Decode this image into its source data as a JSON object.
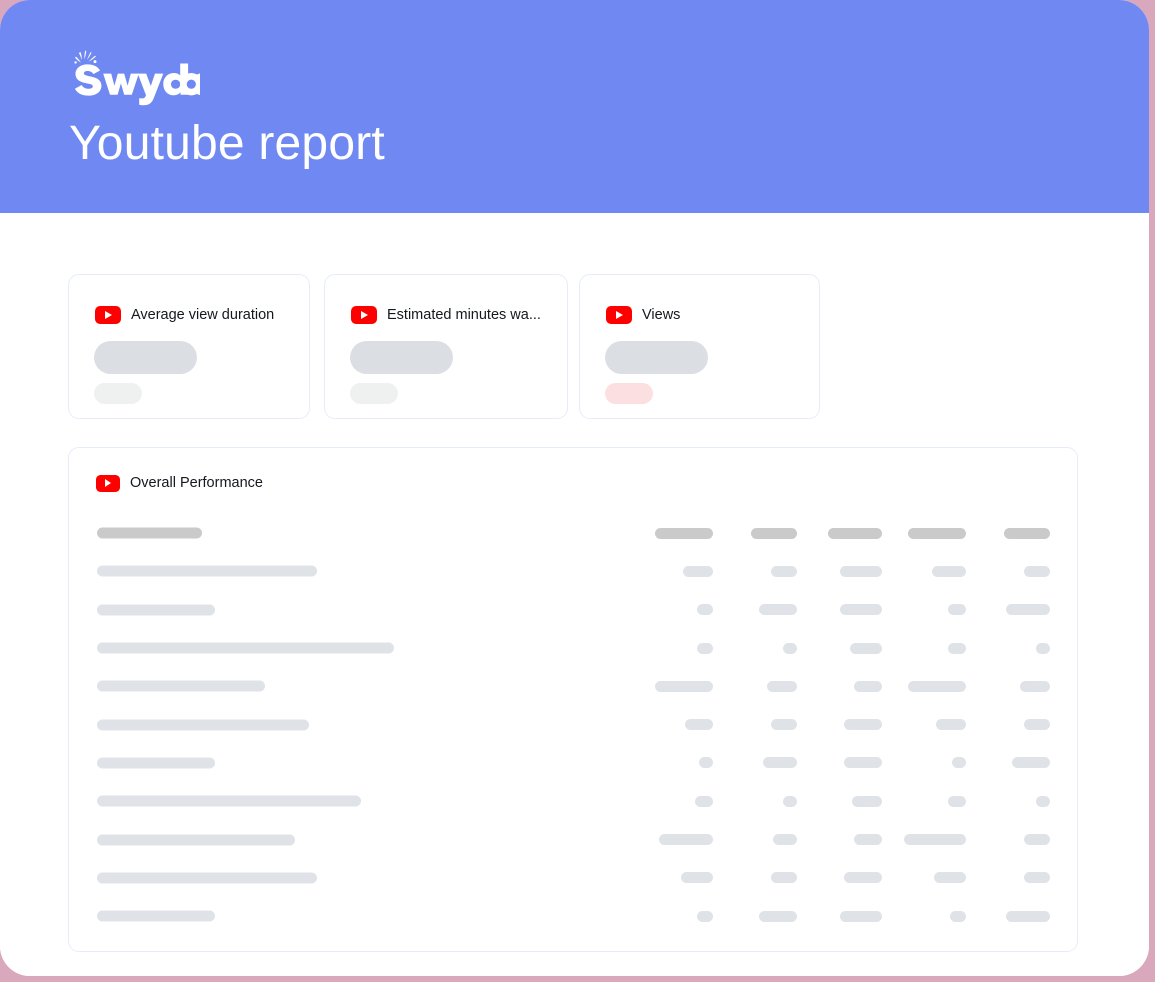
{
  "brand": {
    "logo_text": "Swydo",
    "logo_icon": "swydo-sparkle-logo",
    "banner_color": "#7089f2",
    "frame_color": "#d9a8bd"
  },
  "header": {
    "title": "Youtube report"
  },
  "kpi_cards": [
    {
      "icon": "youtube-icon",
      "label": "Average view duration",
      "value_placeholder_color": "#dbdfe3",
      "delta_placeholder_color": "#eef1f0"
    },
    {
      "icon": "youtube-icon",
      "label": "Estimated minutes wa...",
      "value_placeholder_color": "#dbdfe3",
      "delta_placeholder_color": "#eef1f0"
    },
    {
      "icon": "youtube-icon",
      "label": "Views",
      "value_placeholder_color": "#dbdfe3",
      "delta_placeholder_color": "#fcdfe1"
    }
  ],
  "performance_panel": {
    "icon": "youtube-icon",
    "label": "Overall Performance",
    "skeleton_colors": {
      "header": "#cacaca",
      "body": "#dfe3e8"
    },
    "column_count": 5,
    "rows": [
      {
        "header": true,
        "left_width": 105,
        "cells": [
          58,
          46,
          54,
          58,
          46
        ]
      },
      {
        "header": false,
        "left_width": 220,
        "cells": [
          30,
          26,
          42,
          34,
          26
        ]
      },
      {
        "header": false,
        "left_width": 118,
        "cells": [
          16,
          38,
          42,
          18,
          44
        ]
      },
      {
        "header": false,
        "left_width": 297,
        "cells": [
          16,
          14,
          32,
          18,
          14
        ]
      },
      {
        "header": false,
        "left_width": 168,
        "cells": [
          58,
          30,
          28,
          58,
          30
        ]
      },
      {
        "header": false,
        "left_width": 212,
        "cells": [
          28,
          26,
          38,
          30,
          26
        ]
      },
      {
        "header": false,
        "left_width": 118,
        "cells": [
          14,
          34,
          38,
          14,
          38
        ]
      },
      {
        "header": false,
        "left_width": 264,
        "cells": [
          18,
          14,
          30,
          18,
          14
        ]
      },
      {
        "header": false,
        "left_width": 198,
        "cells": [
          54,
          24,
          28,
          62,
          26
        ]
      },
      {
        "header": false,
        "left_width": 220,
        "cells": [
          32,
          26,
          38,
          32,
          26
        ]
      },
      {
        "header": false,
        "left_width": 118,
        "cells": [
          16,
          38,
          42,
          16,
          44
        ]
      }
    ]
  }
}
